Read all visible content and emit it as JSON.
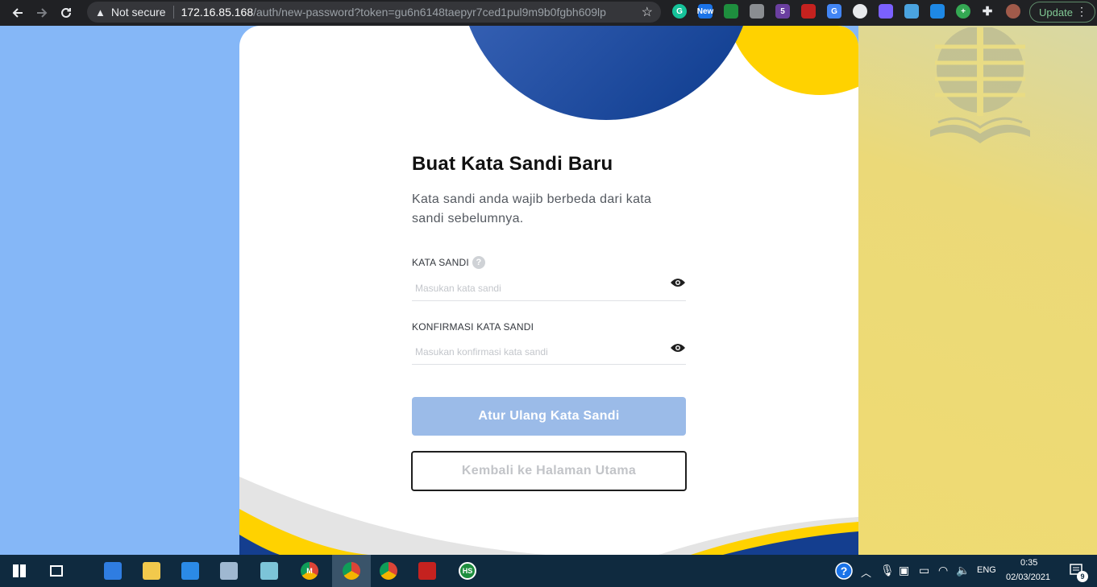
{
  "browser": {
    "security_label": "Not secure",
    "url_host": "172.16.85.168",
    "url_path": "/auth/new-password?token=gu6n6148taepyr7ced1pul9m9b0fgbh609lp",
    "extensions": [
      {
        "name": "grammarly-extension",
        "label": "G",
        "color": "#15c39a"
      },
      {
        "name": "new-badge-extension",
        "label": "New",
        "color": "#1a73e8"
      },
      {
        "name": "crescent-extension",
        "label": "",
        "color": "#1e8e3e"
      },
      {
        "name": "gray-square-extension",
        "label": "",
        "color": "#8a8d91"
      },
      {
        "name": "purple-cubes-extension",
        "label": "5",
        "color": "#6b3fa0"
      },
      {
        "name": "red-eye-extension",
        "label": "",
        "color": "#c5221f"
      },
      {
        "name": "translate-extension",
        "label": "G",
        "color": "#4285f4"
      },
      {
        "name": "compass-extension",
        "label": "",
        "color": "#e8eaed"
      },
      {
        "name": "gear-purple-extension",
        "label": "",
        "color": "#7b61ff"
      },
      {
        "name": "plane-extension",
        "label": "",
        "color": "#4aa3df"
      },
      {
        "name": "screen-extension",
        "label": "",
        "color": "#1e88e5"
      },
      {
        "name": "plus-green-extension",
        "label": "+",
        "color": "#34a853"
      }
    ],
    "update_label": "Update"
  },
  "form": {
    "title": "Buat Kata Sandi Baru",
    "description": "Kata sandi anda wajib berbeda dari kata sandi sebelumnya.",
    "password_label": "KATA SANDI",
    "help_glyph": "?",
    "password_placeholder": "Masukan kata sandi",
    "confirm_label": "KONFIRMASI KATA SANDI",
    "confirm_placeholder": "Masukan konfirmasi kata sandi",
    "submit_label": "Atur Ulang Kata Sandi",
    "back_label": "Kembali ke Halaman Utama"
  },
  "colors": {
    "left_bg": "#85b7f7",
    "right_bg": "#efdb72",
    "navy": "#143e8f",
    "yellow": "#ffd200",
    "primary_button": "#9bbbe8"
  },
  "taskbar": {
    "apps": [
      {
        "name": "windows-start-icon",
        "label": ""
      },
      {
        "name": "task-view-icon",
        "label": ""
      },
      {
        "name": "todo-app-icon",
        "label": ""
      },
      {
        "name": "file-explorer-icon",
        "label": ""
      },
      {
        "name": "vscode-icon",
        "label": ""
      },
      {
        "name": "network-app-icon",
        "label": ""
      },
      {
        "name": "notes-app-icon",
        "label": ""
      },
      {
        "name": "chrome-profile-m-icon",
        "label": "M"
      },
      {
        "name": "chrome-profile-active-icon",
        "label": ""
      },
      {
        "name": "chrome-icon",
        "label": ""
      },
      {
        "name": "acrobat-icon",
        "label": ""
      },
      {
        "name": "hs-app-icon",
        "label": "HS"
      }
    ],
    "language": "ENG",
    "time": "0:35",
    "date": "02/03/2021",
    "notification_count": "9"
  }
}
